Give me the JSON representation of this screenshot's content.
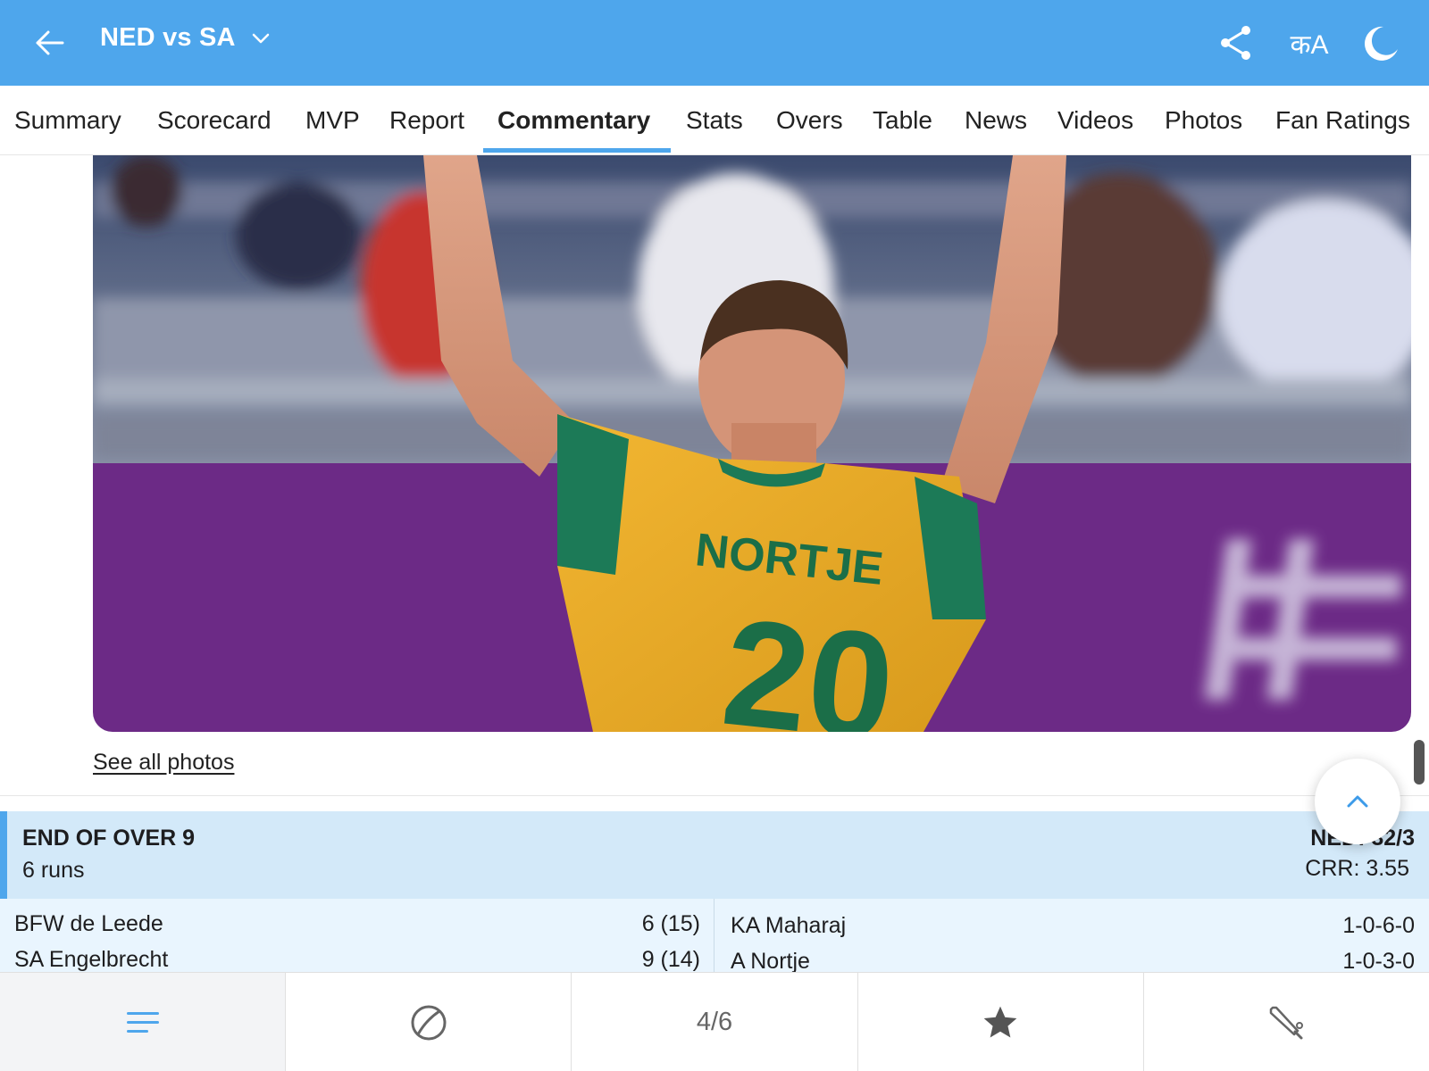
{
  "header": {
    "title": "NED vs SA",
    "back_icon": "arrow-left-icon",
    "dropdown_icon": "chevron-down-icon",
    "share_icon": "share-icon",
    "language_label": "कA",
    "theme_icon": "moon-icon",
    "color": "#4ea6ec"
  },
  "tabs": [
    {
      "label": "Summary"
    },
    {
      "label": "Scorecard"
    },
    {
      "label": "MVP"
    },
    {
      "label": "Report"
    },
    {
      "label": "Commentary",
      "active": true
    },
    {
      "label": "Stats"
    },
    {
      "label": "Overs"
    },
    {
      "label": "Table"
    },
    {
      "label": "News"
    },
    {
      "label": "Videos"
    },
    {
      "label": "Photos"
    },
    {
      "label": "Fan Ratings"
    }
  ],
  "photo": {
    "jersey_name": "NORTJE",
    "jersey_number": "20"
  },
  "see_all_photos": "See all photos",
  "over_summary": {
    "title": "END OF OVER 9",
    "runs": "6 runs",
    "score": "NED: 32/3",
    "crr": "CRR: 3.55"
  },
  "batters": [
    {
      "name": "BFW de Leede",
      "figures": "6 (15)"
    },
    {
      "name": "SA Engelbrecht",
      "figures": "9 (14)"
    }
  ],
  "bowlers": [
    {
      "name": "KA Maharaj",
      "figures": "1-0-6-0"
    },
    {
      "name": "A Nortje",
      "figures": "1-0-3-0"
    }
  ],
  "bottom_bar": {
    "items": [
      {
        "icon": "list-icon",
        "active": true
      },
      {
        "icon": "ball-icon"
      },
      {
        "label": "4/6"
      },
      {
        "icon": "star-icon"
      },
      {
        "icon": "cricket-bat-icon"
      }
    ]
  },
  "scroll_up_icon": "chevron-up-icon"
}
